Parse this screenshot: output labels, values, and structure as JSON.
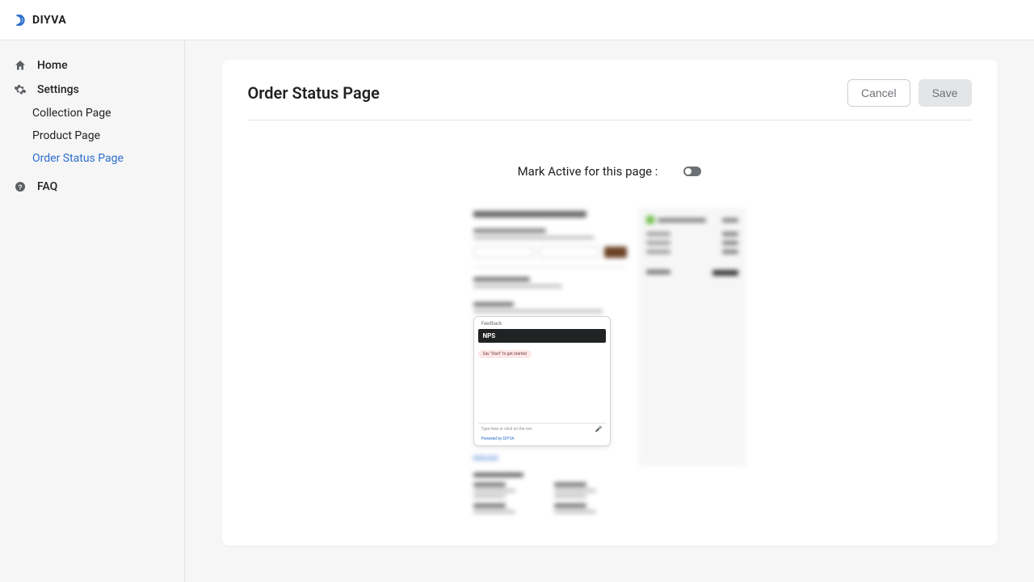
{
  "brand": {
    "name": "DIYVA"
  },
  "sidebar": {
    "home": "Home",
    "settings": "Settings",
    "subitems": [
      "Collection Page",
      "Product Page",
      "Order Status Page"
    ],
    "faq": "FAQ"
  },
  "page": {
    "title": "Order Status Page",
    "cancel": "Cancel",
    "save": "Save",
    "toggleLabel": "Mark Active for this page :",
    "toggleState": false
  },
  "preview": {
    "feedback_label": "Feedback",
    "nps": "NPS",
    "chip": "Say \"Start\" to get started",
    "input_placeholder": "Type here or click on the mic",
    "powered": "Powered by DIYVA"
  }
}
